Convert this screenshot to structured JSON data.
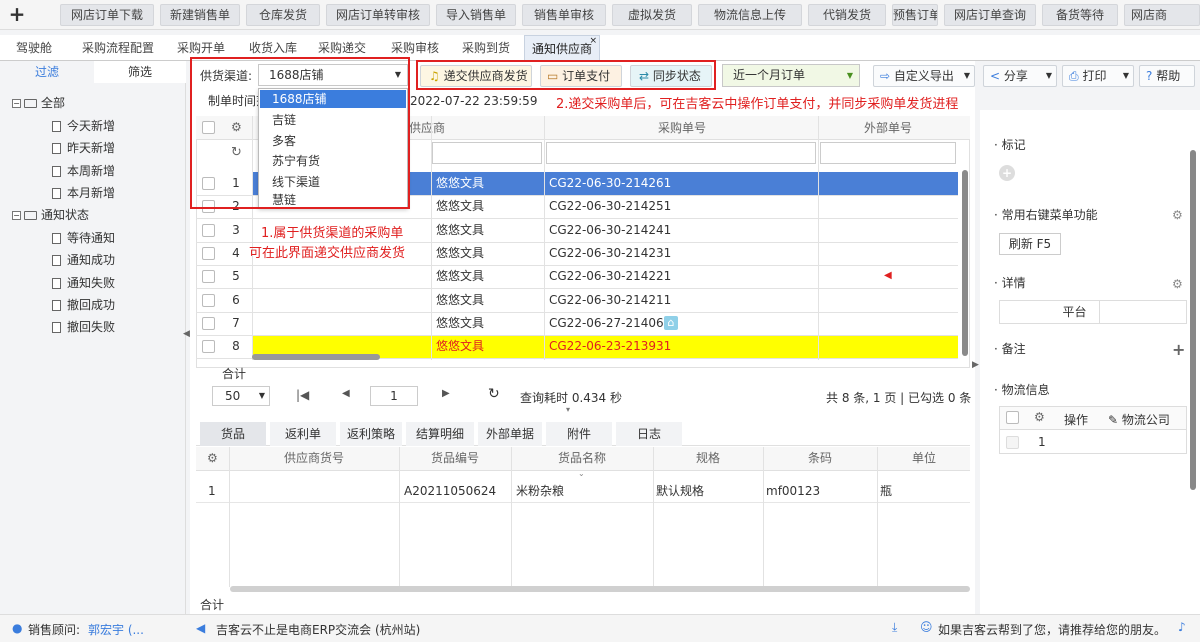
{
  "top_tabs": [
    "网店订单下载",
    "新建销售单",
    "仓库发货",
    "网店订单转审核",
    "导入销售单",
    "销售单审核",
    "虚拟发货",
    "物流信息上传",
    "代销发货",
    "预售订单",
    "网店订单查询",
    "备货等待",
    "网店商"
  ],
  "sub_tabs": [
    "驾驶舱",
    "采购流程配置",
    "采购开单",
    "收货入库",
    "采购递交",
    "采购审核",
    "采购到货",
    "通知供应商"
  ],
  "left": {
    "tab_filter": "过滤",
    "tab_select": "筛选",
    "groups": [
      {
        "label": "全部",
        "items": [
          "今天新增",
          "昨天新增",
          "本周新增",
          "本月新增"
        ]
      },
      {
        "label": "通知状态",
        "items": [
          "等待通知",
          "通知成功",
          "通知失败",
          "撤回成功",
          "撤回失败"
        ]
      }
    ]
  },
  "toolbar": {
    "channel_label": "供货渠道:",
    "channel_value": "1688店铺",
    "channel_options": [
      "1688店铺",
      "吉链",
      "多客",
      "苏宁有货",
      "线下渠道",
      "慧链"
    ],
    "submit_btn": "递交供应商发货",
    "pay_btn": "订单支付",
    "sync_btn": "同步状态",
    "period_value": "近一个月订单",
    "export_btn": "自定义导出",
    "share_btn": "分享",
    "print_btn": "打印",
    "help_btn": "帮助"
  },
  "date_label": "制单时间范",
  "date_end": "2022-07-22 23:59:59",
  "annotation1_line1": "1.属于供货渠道的采购单",
  "annotation1_line2": "可在此界面递交供应商发货",
  "annotation2": "2.递交采购单后，可在吉客云中操作订单支付，并同步采购单发货进程",
  "table": {
    "col_supplier": "供应商",
    "col_po": "采购单号",
    "col_external": "外部单号",
    "rows": [
      {
        "no": "1",
        "supplier": "悠悠文具",
        "po": "CG22-06-30-214261"
      },
      {
        "no": "2",
        "supplier": "悠悠文具",
        "po": "CG22-06-30-214251"
      },
      {
        "no": "3",
        "supplier": "悠悠文具",
        "po": "CG22-06-30-214241"
      },
      {
        "no": "4",
        "supplier": "悠悠文具",
        "po": "CG22-06-30-214231"
      },
      {
        "no": "5",
        "supplier": "悠悠文具",
        "po": "CG22-06-30-214221"
      },
      {
        "no": "6",
        "supplier": "悠悠文具",
        "po": "CG22-06-30-214211"
      },
      {
        "no": "7",
        "supplier": "悠悠文具",
        "po": "CG22-06-27-214061"
      },
      {
        "no": "8",
        "supplier": "悠悠文具",
        "po": "CG22-06-23-213931"
      }
    ],
    "total_label": "合计"
  },
  "pager": {
    "page_size": "50",
    "page": "1",
    "query_time": "查询耗时 0.434 秒",
    "summary": "共 8 条, 1 页 | 已勾选 0 条"
  },
  "bottom_tabs": [
    "货品",
    "返利单",
    "返利策略",
    "结算明细",
    "外部单据",
    "附件",
    "日志"
  ],
  "detail": {
    "headers": [
      "供应商货号",
      "货品编号",
      "货品名称",
      "规格",
      "条码",
      "单位"
    ],
    "row": {
      "no": "1",
      "supplier_code": "",
      "goods_no": "A20211050624",
      "goods_name": "米粉杂粮",
      "spec": "默认规格",
      "barcode": "mf00123",
      "unit": "瓶"
    },
    "total_label": "合计"
  },
  "right": {
    "mark_title": "标记",
    "context_title": "常用右键菜单功能",
    "refresh_btn": "刷新 F5",
    "detail_title": "详情",
    "platform_label": "平台",
    "remark_title": "备注",
    "logistics_title": "物流信息",
    "log_col_op": "操作",
    "log_col_company": "物流公司",
    "log_row_no": "1"
  },
  "status": {
    "advisor_label": "销售顾问:",
    "advisor_name": "郭宏宇 (...",
    "notice": "吉客云不止是电商ERP交流会 (杭州站)",
    "recommend": "如果吉客云帮到了您，请推荐给您的朋友。"
  },
  "colors": {
    "selected_row": "#4a7fd6",
    "highlight_row": "#ffff00",
    "annotation": "#e02020"
  }
}
